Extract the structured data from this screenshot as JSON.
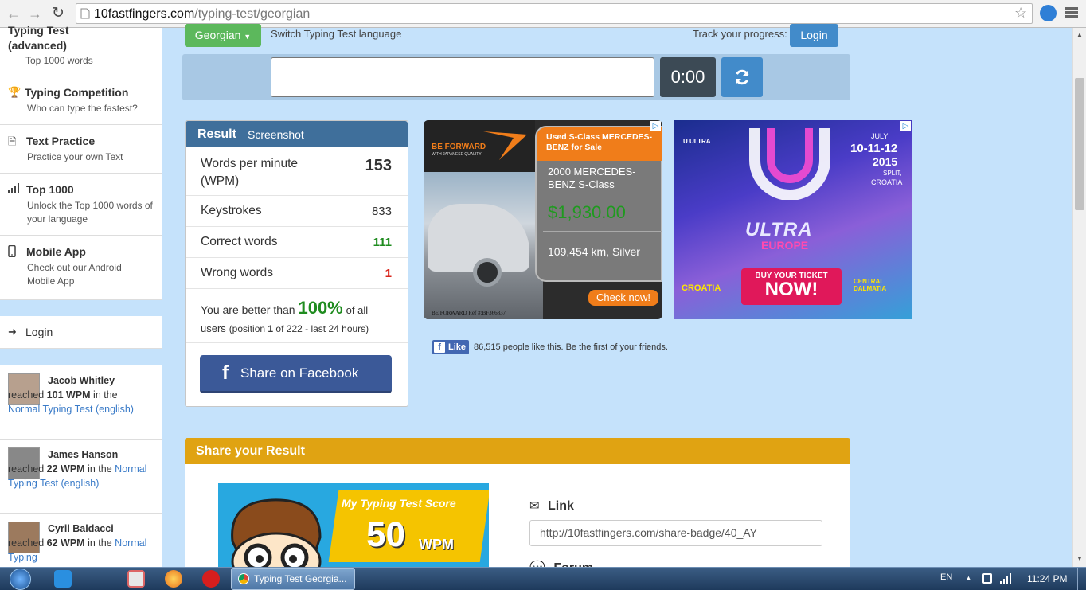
{
  "browser": {
    "url_host": "10fastfingers.com",
    "url_path": "/typing-test/georgian"
  },
  "sidebar": {
    "items": [
      {
        "title": "Typing Test",
        "title2": "(advanced)",
        "sub": "Top 1000 words"
      },
      {
        "title": "Typing Competition",
        "sub": "Who can type the fastest?"
      },
      {
        "title": "Text Practice",
        "sub": "Practice your own Text"
      },
      {
        "title": "Top 1000",
        "sub": "Unlock the Top 1000 words of your language"
      },
      {
        "title": "Mobile App",
        "sub": "Check out our Android Mobile App"
      }
    ],
    "login": "Login",
    "feed": [
      {
        "name": "Jacob Whitley",
        "reached": "reached",
        "wpm": "101 WPM",
        "in_the": "in the",
        "link": "Normal Typing Test (english)"
      },
      {
        "name": "James Hanson",
        "reached": "reached",
        "wpm": "22 WPM",
        "in_the": "in the",
        "link": "Normal Typing Test (english)"
      },
      {
        "name": "Cyril Baldacci",
        "reached": "reached",
        "wpm": "62 WPM",
        "in_the": "in the",
        "link": "Normal Typing"
      }
    ]
  },
  "top": {
    "language": "Georgian",
    "switch_label": "Switch Typing Test language",
    "track_label": "Track your progress:",
    "login": "Login",
    "timer": "0:00"
  },
  "result": {
    "title": "Result",
    "screenshot": "Screenshot",
    "wpm_label": "Words per minute (WPM)",
    "wpm_value": "153",
    "keystrokes_label": "Keystrokes",
    "keystrokes_value": "833",
    "correct_label": "Correct words",
    "correct_value": "111",
    "wrong_label": "Wrong words",
    "wrong_value": "1",
    "better_prefix": "You are better than",
    "better_pct": "100%",
    "better_suffix": "of all users",
    "position_prefix": "(position",
    "position_value": "1",
    "position_suffix": "of 222 - last 24 hours)",
    "fb_share": "Share on Facebook"
  },
  "ads": {
    "ad1": {
      "brand": "BE FORWARD",
      "brand_sub": "WITH JAPANESE QUALITY",
      "headline": "Used S-Class MERCEDES-BENZ for Sale",
      "model": "2000 MERCEDES-BENZ S-Class",
      "price": "$1,930.00",
      "details": "109,454 km, Silver",
      "cta": "Check now!",
      "ref": "BE FORWARD Ref #:BF366837"
    },
    "ad2": {
      "date_month": "JULY",
      "dates": "10-11-12",
      "year": "2015",
      "city": "SPLIT,",
      "country": "CROATIA",
      "title": "ULTRA",
      "subtitle": "EUROPE",
      "cta_top": "BUY YOUR TICKET",
      "cta_main": "NOW!",
      "left_logo": "CROATIA",
      "right_logo": "CENTRAL DALMATIA"
    }
  },
  "fb_like": {
    "button": "Like",
    "text": "86,515 people like this. Be the first of your friends."
  },
  "share": {
    "title": "Share your Result",
    "badge_title": "My Typing Test Score",
    "badge_wpm": "50",
    "badge_unit": "WPM",
    "link_label": "Link",
    "link_value": "http://10fastfingers.com/share-badge/40_AY",
    "forum_label": "Forum"
  },
  "taskbar": {
    "tab": "Typing Test Georgia...",
    "lang": "EN",
    "clock": "11:24 PM"
  },
  "colors": {
    "page_bg": "#c5e2fb",
    "green": "#5cb85c",
    "blue": "#428bca",
    "result_head": "#3f6f9b",
    "correct": "#1f8c1f",
    "wrong": "#d9261c",
    "share_head": "#e0a312",
    "facebook": "#3b5998"
  }
}
